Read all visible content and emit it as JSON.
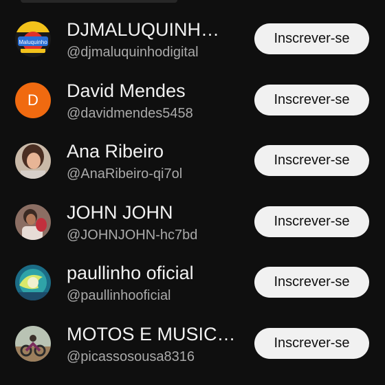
{
  "channels": [
    {
      "name": "DJMALUQUINH…",
      "handle": "@djmaluquinhodigital",
      "avatar": "dj-logo-avatar",
      "avatar_text": "Maluquinho"
    },
    {
      "name": "David Mendes",
      "handle": "@davidmendes5458",
      "avatar": "letter-avatar",
      "avatar_letter": "D",
      "avatar_color": "#f06a10"
    },
    {
      "name": "Ana Ribeiro",
      "handle": "@AnaRibeiro-qi7ol",
      "avatar": "photo-avatar"
    },
    {
      "name": "JOHN JOHN",
      "handle": "@JOHNJOHN-hc7bd",
      "avatar": "photo-avatar"
    },
    {
      "name": "paullinho oficial",
      "handle": "@paullinhooficial",
      "avatar": "wave-avatar"
    },
    {
      "name": "MOTOS E MUSIC…",
      "handle": "@picassosousa8316",
      "avatar": "motorcycle-avatar"
    }
  ],
  "subscribe_label": "Inscrever-se",
  "colors": {
    "background": "#0f0f0f",
    "button_bg": "#f1f1f1",
    "secondary_text": "#aaaaaa"
  }
}
